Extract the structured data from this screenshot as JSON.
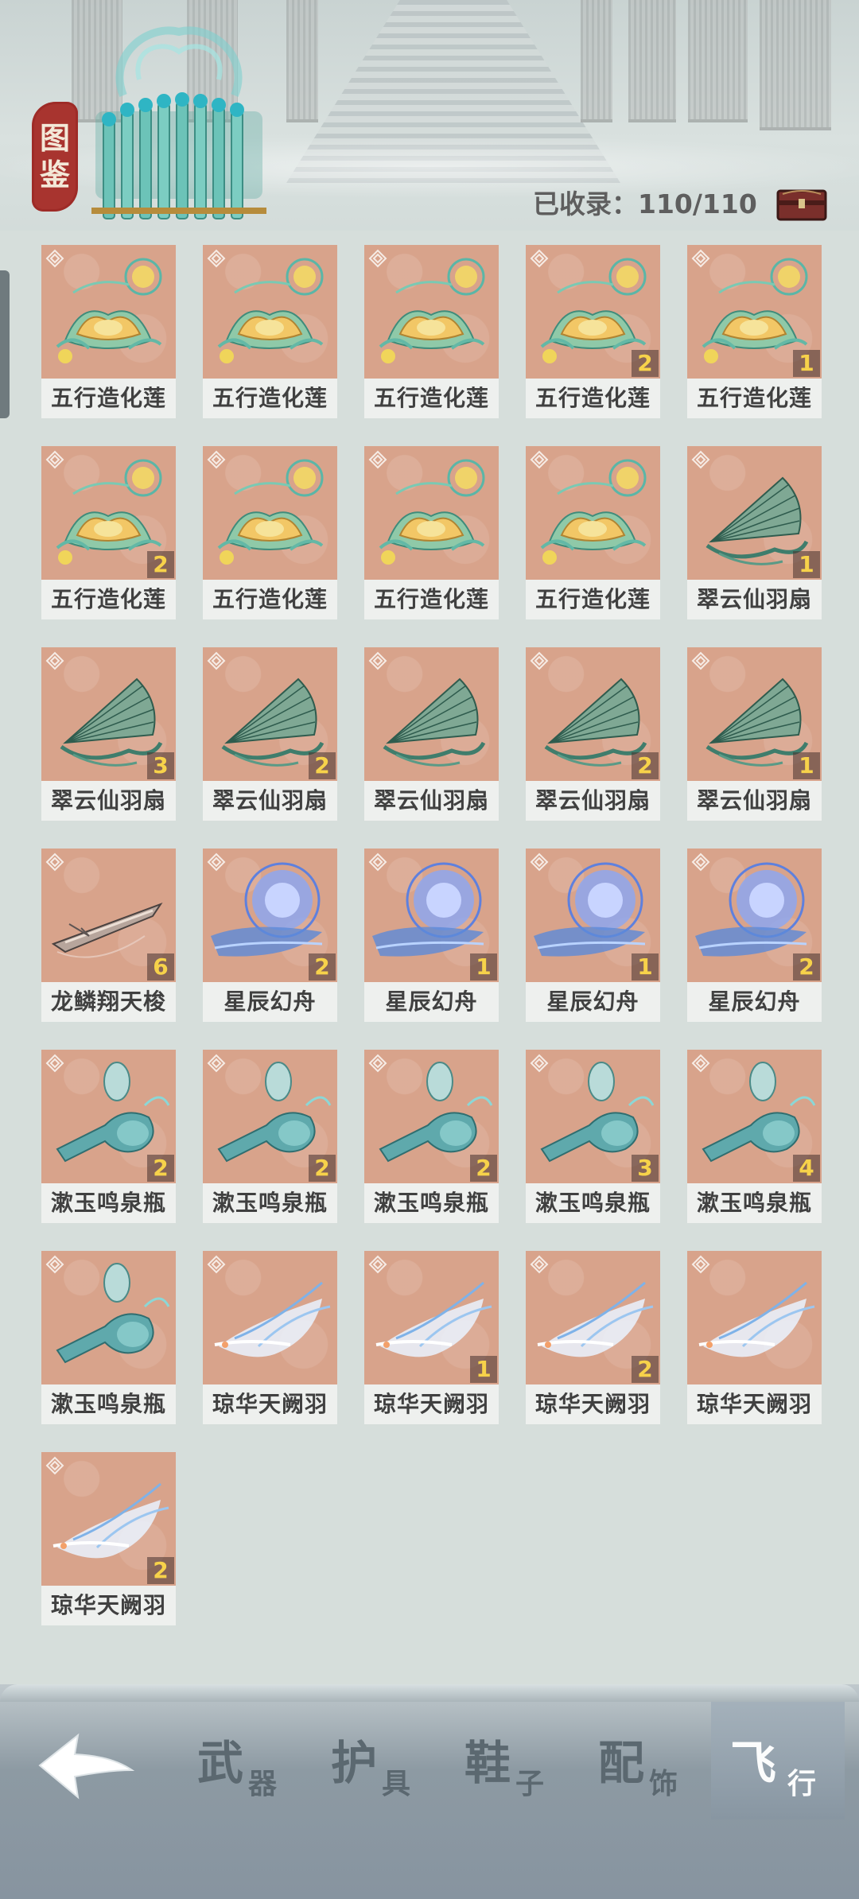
{
  "header": {
    "seal_text": [
      "图",
      "鉴"
    ],
    "collected_label": "已收录：110/110",
    "chest_icon": "treasure-chest-icon"
  },
  "grid_items": [
    {
      "name": "五行造化莲",
      "art": "lotus",
      "count": ""
    },
    {
      "name": "五行造化莲",
      "art": "lotus",
      "count": ""
    },
    {
      "name": "五行造化莲",
      "art": "lotus",
      "count": ""
    },
    {
      "name": "五行造化莲",
      "art": "lotus",
      "count": "2"
    },
    {
      "name": "五行造化莲",
      "art": "lotus",
      "count": "1"
    },
    {
      "name": "五行造化莲",
      "art": "lotus",
      "count": "2"
    },
    {
      "name": "五行造化莲",
      "art": "lotus",
      "count": ""
    },
    {
      "name": "五行造化莲",
      "art": "lotus",
      "count": ""
    },
    {
      "name": "五行造化莲",
      "art": "lotus",
      "count": ""
    },
    {
      "name": "翠云仙羽扇",
      "art": "fan",
      "count": "1"
    },
    {
      "name": "翠云仙羽扇",
      "art": "fan",
      "count": "3"
    },
    {
      "name": "翠云仙羽扇",
      "art": "fan",
      "count": "2"
    },
    {
      "name": "翠云仙羽扇",
      "art": "fan",
      "count": ""
    },
    {
      "name": "翠云仙羽扇",
      "art": "fan",
      "count": "2"
    },
    {
      "name": "翠云仙羽扇",
      "art": "fan",
      "count": "1"
    },
    {
      "name": "龙鳞翔天梭",
      "art": "shuttle",
      "count": "6"
    },
    {
      "name": "星辰幻舟",
      "art": "boat",
      "count": "2"
    },
    {
      "name": "星辰幻舟",
      "art": "boat",
      "count": "1"
    },
    {
      "name": "星辰幻舟",
      "art": "boat",
      "count": "1"
    },
    {
      "name": "星辰幻舟",
      "art": "boat",
      "count": "2"
    },
    {
      "name": "漱玉鸣泉瓶",
      "art": "vase",
      "count": "2"
    },
    {
      "name": "漱玉鸣泉瓶",
      "art": "vase",
      "count": "2"
    },
    {
      "name": "漱玉鸣泉瓶",
      "art": "vase",
      "count": "2"
    },
    {
      "name": "漱玉鸣泉瓶",
      "art": "vase",
      "count": "3"
    },
    {
      "name": "漱玉鸣泉瓶",
      "art": "vase",
      "count": "4"
    },
    {
      "name": "漱玉鸣泉瓶",
      "art": "vase",
      "count": ""
    },
    {
      "name": "琼华天阙羽",
      "art": "feather",
      "count": ""
    },
    {
      "name": "琼华天阙羽",
      "art": "feather",
      "count": "1"
    },
    {
      "name": "琼华天阙羽",
      "art": "feather",
      "count": "2"
    },
    {
      "name": "琼华天阙羽",
      "art": "feather",
      "count": ""
    },
    {
      "name": "琼华天阙羽",
      "art": "feather",
      "count": "2"
    }
  ],
  "bottom_nav": {
    "back_icon": "back-arrow-icon",
    "tabs": [
      {
        "big": "武",
        "small": "器",
        "active": false
      },
      {
        "big": "护",
        "small": "具",
        "active": false
      },
      {
        "big": "鞋",
        "small": "子",
        "active": false
      },
      {
        "big": "配",
        "small": "饰",
        "active": false
      },
      {
        "big": "飞",
        "small": "行",
        "active": true
      }
    ]
  },
  "colors": {
    "card_bg": "#d8a38b",
    "count_text": "#f7d24a",
    "seal_red": "#a8342f"
  }
}
